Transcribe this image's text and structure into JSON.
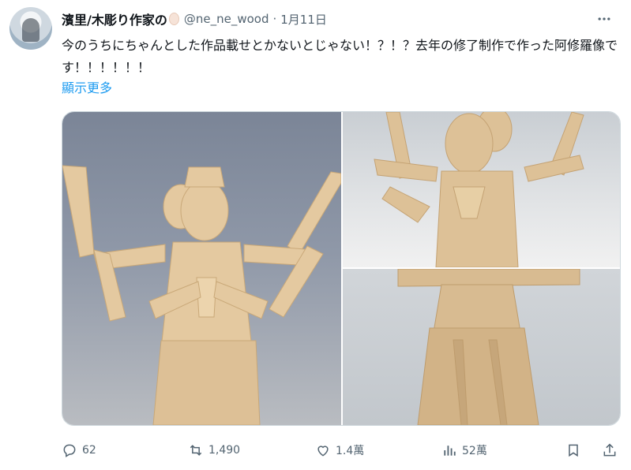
{
  "author": {
    "display_name": "濱里/木彫り作家の",
    "handle": "@ne_ne_wood",
    "separator": "·",
    "timestamp": "1月11日",
    "avatar_icon": "profile-photo",
    "emoji_icon": "egg-emoji"
  },
  "tweet": {
    "text": "今のうちにちゃんとした作品載せとかないとじゃない！？！？去年の修了制作で作った阿修羅像です！！！！！！",
    "show_more": "顯示更多"
  },
  "media": {
    "photo_count": 3,
    "subject_icons": [
      "asura-statue-front",
      "asura-statue-upper-body",
      "asura-statue-lower-body"
    ]
  },
  "actions": {
    "reply_count": "62",
    "retweet_count": "1,490",
    "like_count": "1.4萬",
    "view_count": "52萬",
    "icons": [
      "reply-icon",
      "retweet-icon",
      "like-icon",
      "views-icon",
      "bookmark-icon",
      "share-icon"
    ]
  },
  "colors": {
    "text_primary": "#0f1419",
    "text_secondary": "#536471",
    "link": "#1d9bf0",
    "border": "#cfd9de"
  }
}
